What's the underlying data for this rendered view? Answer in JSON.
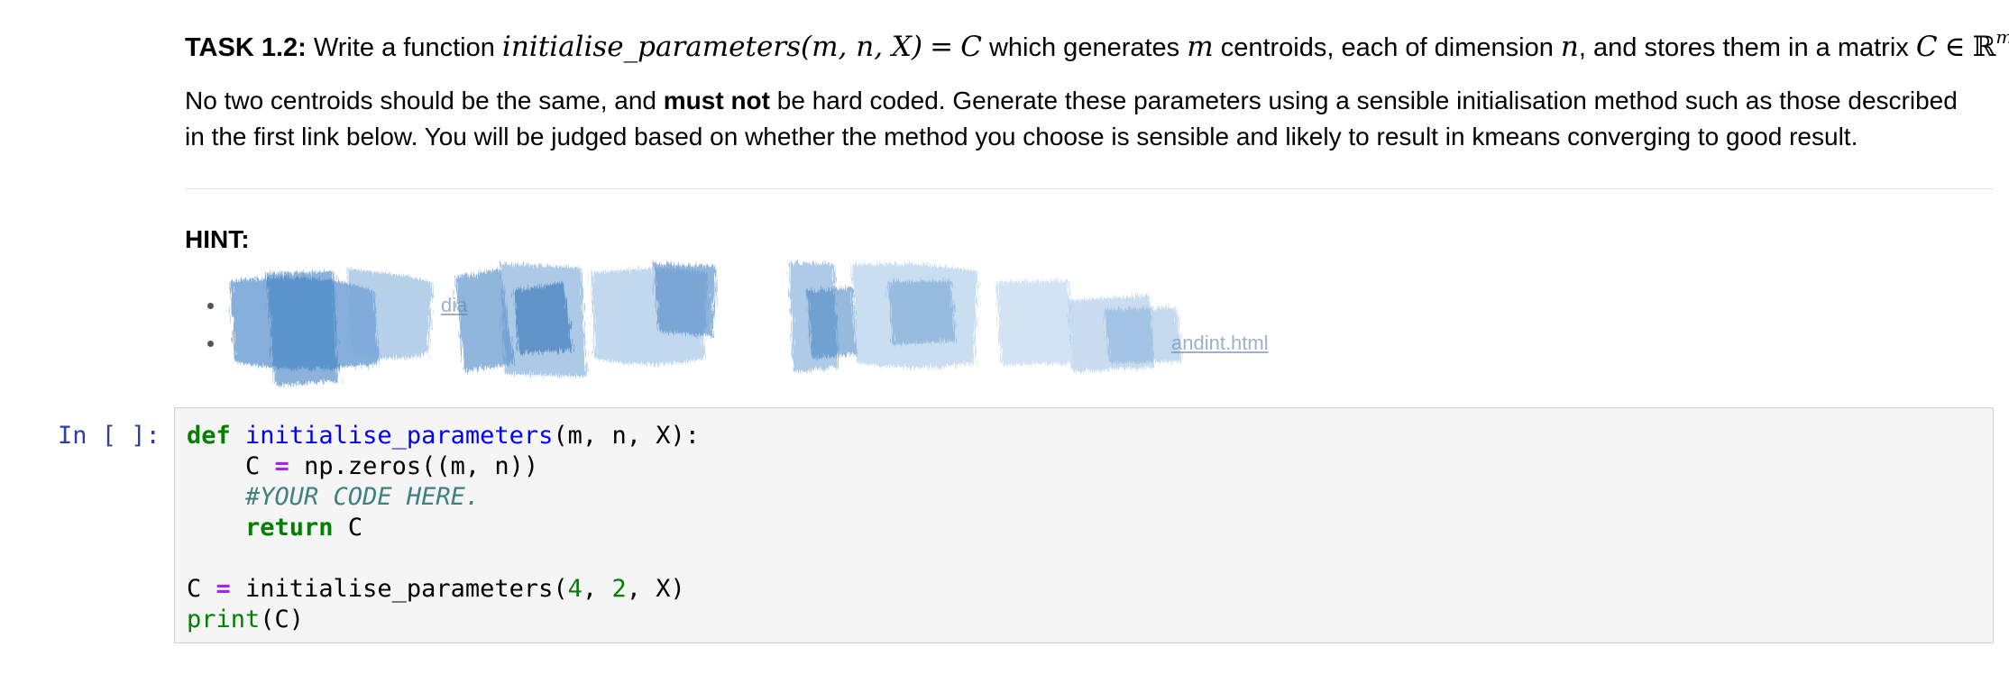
{
  "markdown": {
    "task_label": "TASK 1.2:",
    "task_text_1": "Write a function",
    "function_signature": "initialise_parameters(m, n, X)",
    "equals": "=",
    "return_symbol": "C",
    "task_text_2": "which generates",
    "m_symbol": "m",
    "task_text_3": "centroids, each of dimension",
    "n_symbol": "n",
    "task_text_4": ", and stores them in a matrix",
    "matrix_symbol": "C",
    "element_of": "∈",
    "reals_symbol": "ℝ",
    "dimension_superscript": "m×n",
    "period": ".",
    "paragraph_line_1a": "No two centroids should be the same, and",
    "paragraph_bold": "must not",
    "paragraph_line_1b": "be hard coded. Generate these parameters using a sensible initialisation method such as those described",
    "paragraph_line_2": "in the first link below. You will be judged based on whether the method you choose is sensible and likely to result in kmeans converging to good result.",
    "hint_heading": "HINT:",
    "hint_link_1_visible": "dia",
    "hint_link_2_visible": "andint.html"
  },
  "code_cell": {
    "prompt": "In [ ]:",
    "lines": {
      "l1_kw": "def",
      "l1_fn": "initialise_parameters",
      "l1_rest": "(m, n, X):",
      "l2_indent": "    C ",
      "l2_op": "=",
      "l2_rest": " np.zeros((m, n))",
      "l3_comment": "    #YOUR CODE HERE.",
      "l4_indent": "    ",
      "l4_kw": "return",
      "l4_rest": " C",
      "l6_start": "C ",
      "l6_op": "=",
      "l6_call": " initialise_parameters(",
      "l6_num1": "4",
      "l6_sep1": ", ",
      "l6_num2": "2",
      "l6_end": ", X)",
      "l7_builtin": "print",
      "l7_rest": "(C)"
    }
  },
  "colors": {
    "prompt": "#303f9f",
    "keyword": "#008000",
    "function_name": "#0000ff",
    "operator": "#aa22ff",
    "comment": "#408080",
    "redaction_scribble": "#4a86c5"
  }
}
